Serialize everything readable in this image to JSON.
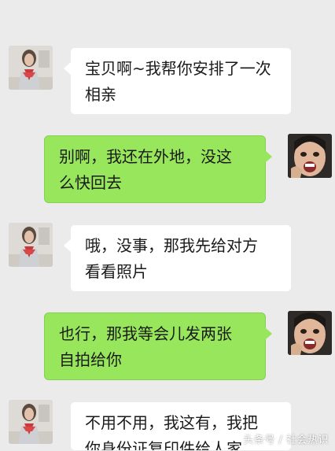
{
  "messages": [
    {
      "sender": "mother",
      "lines": [
        "宝贝啊~我帮你安排了一次",
        "相亲"
      ]
    },
    {
      "sender": "me",
      "lines": [
        "别啊，我还在外地，没这",
        "么快回去"
      ]
    },
    {
      "sender": "mother",
      "lines": [
        "哦，没事，那我先给对方",
        "看看照片"
      ]
    },
    {
      "sender": "me",
      "lines": [
        "也行，那我等会儿发两张",
        "自拍给你"
      ]
    },
    {
      "sender": "mother",
      "lines": [
        "不用不用，我这有，我把",
        "你身份证复印件给人家"
      ]
    }
  ],
  "watermark": "头条号 / 社会热识",
  "colors": {
    "background": "#ebebeb",
    "incoming_bubble": "#ffffff",
    "outgoing_bubble": "#97e65c"
  },
  "icons": {
    "mother_avatar": "avatar-photo-mother",
    "me_avatar": "avatar-photo-child"
  }
}
